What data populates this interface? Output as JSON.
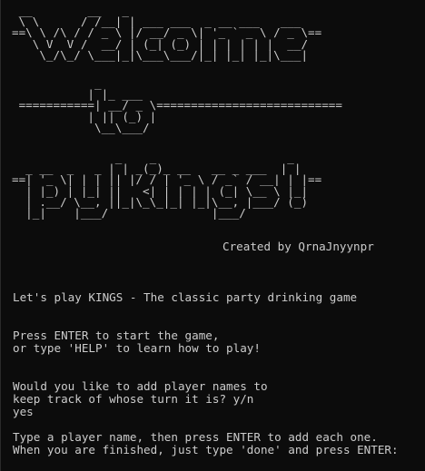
{
  "colors": {
    "background": "#0c0c0c",
    "text": "#cccccc"
  },
  "banner": {
    "welcome": " __        __   _                            \n \\ \\      / /__| | ___ ___  _ __ ___   ___  \n==\\ \\ /\\ / / _ \\ |/ __/ _ \\| '_ ` _ \\ / _ \\==\n   \\ V  V /  __/ | (_| (_) | | | | | |  __/ \n    \\_/\\_/ \\___|_|\\___\\___/|_| |_| |_|\\___| ",
    "to": "            _                                \n           | |_ ___                          \n ===========| __/ _ \\===========================\n           | || (_) |                        \n            \\__\\___/                         ",
    "pykings": "               _    _                   _ \n  _ __  _   _ | | _(_)_ __   __ _ ___  | |\n==| '_ \\| | | || |/ / | '_ \\ / _` / __| | |==\n  | |_) | |_| ||   <| | | | | (_| \\__ \\ |_|\n  | .__/ \\__, ||_|\\_\\_|_| |_|\\__, |___/ (_)\n  |_|    |___/               |___/          "
  },
  "credit": "Created by QrnaJnyynpr",
  "lines": {
    "intro": "Let's play KINGS - The classic party drinking game",
    "press_enter_1": "Press ENTER to start the game,",
    "press_enter_2": "or type 'HELP' to learn how to play!",
    "names_q_1": "Would you like to add player names to",
    "names_q_2": "keep track of whose turn it is? y/n",
    "user_answer": "yes",
    "type_name_1": "Type a player name, then press ENTER to add each one.",
    "type_name_2": "When you are finished, just type 'done' and press ENTER:"
  }
}
